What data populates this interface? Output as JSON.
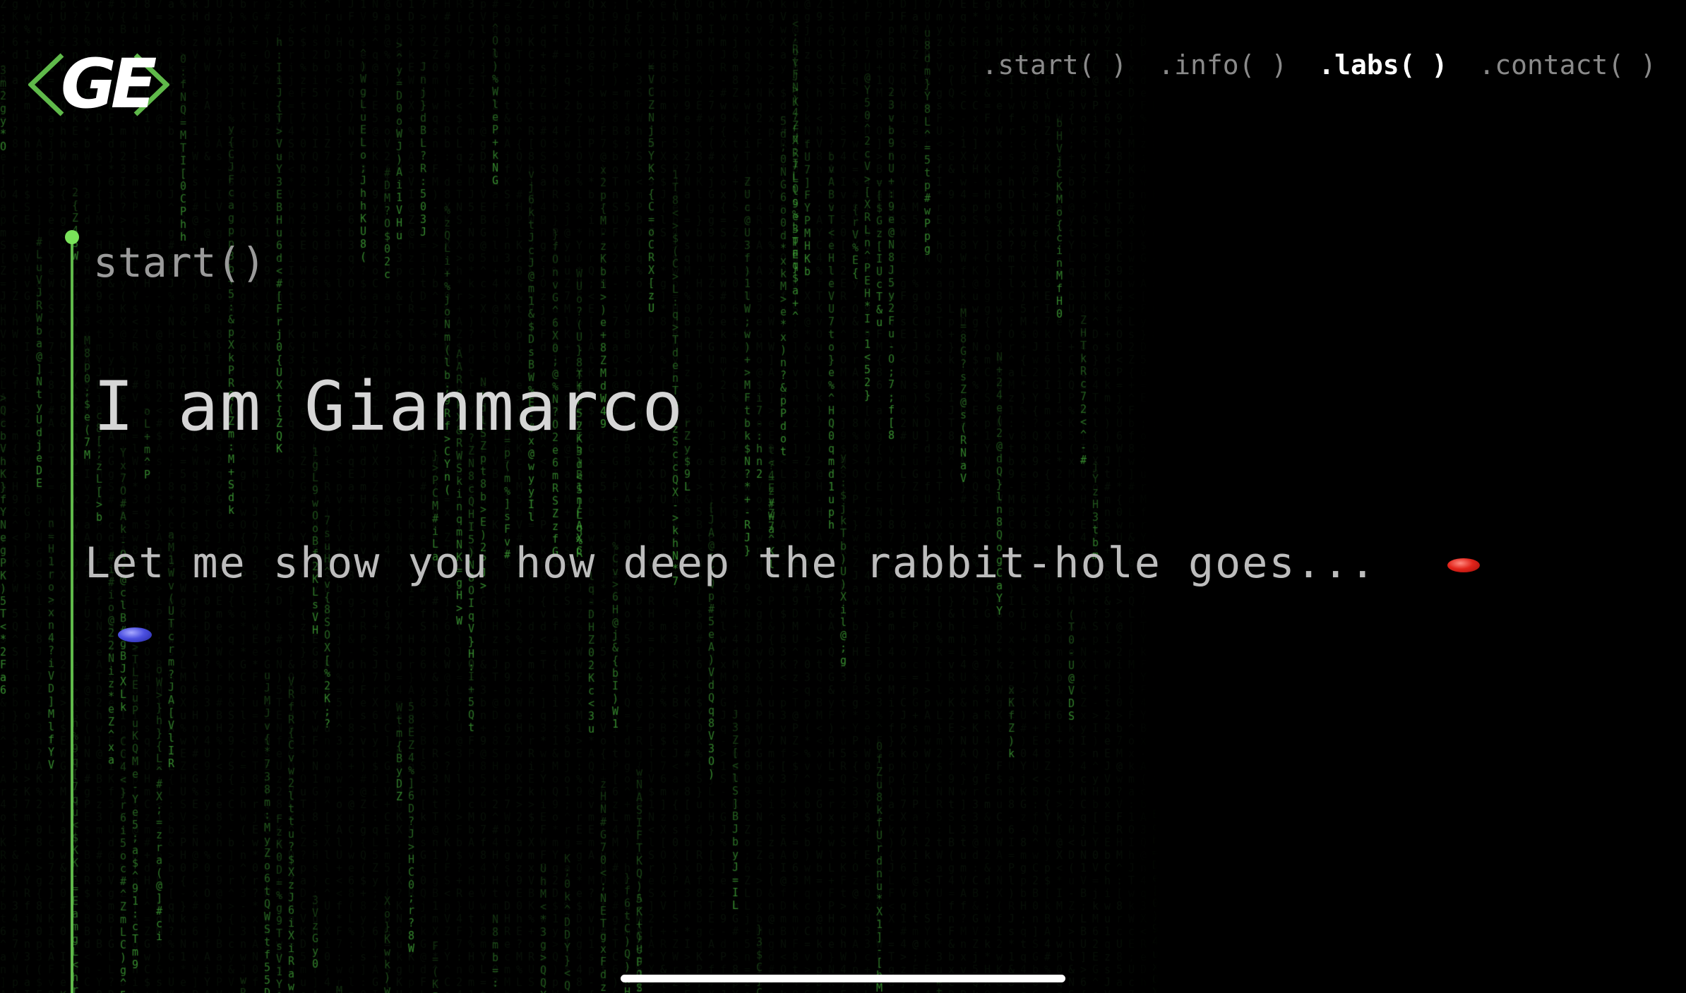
{
  "logo": {
    "text": "GE",
    "accent_color": "#5fb94a"
  },
  "nav": {
    "items": [
      {
        "label": ".start( )",
        "active": false
      },
      {
        "label": ".info( )",
        "active": false
      },
      {
        "label": ".labs( )",
        "active": true
      },
      {
        "label": ".contact( )",
        "active": false
      }
    ]
  },
  "timeline": {
    "color": "#5fb94a",
    "section_label": "start()"
  },
  "hero": {
    "title": "I am Gianmarco",
    "subtitle": "Let me show you how deep the rabbit-hole goes..."
  },
  "pills": {
    "red_color": "#e2241b",
    "blue_color": "#4b4fe0"
  },
  "background": {
    "type": "matrix-code-rain",
    "glyph_color": "#3fa83a"
  }
}
